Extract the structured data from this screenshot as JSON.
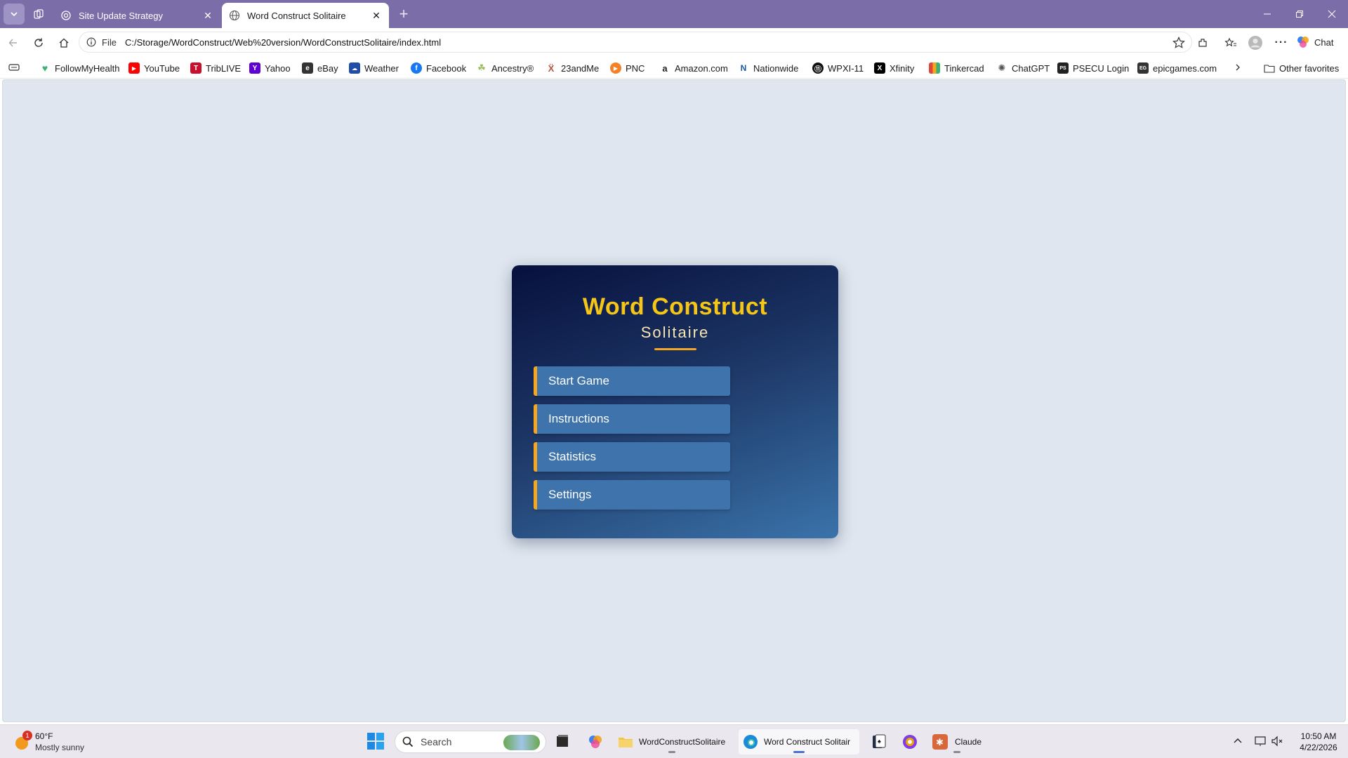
{
  "browser": {
    "tabs": [
      {
        "title": "Site Update Strategy",
        "icon": "openai-icon",
        "active": false
      },
      {
        "title": "Word Construct Solitaire",
        "icon": "globe-icon",
        "active": true
      }
    ],
    "address": {
      "file_label": "File",
      "url": "C:/Storage/WordConstruct/Web%20version/WordConstructSolitaire/index.html"
    },
    "chat_label": "Chat",
    "favorites": [
      {
        "label": "FollowMyHealth",
        "icon": "heart-icon",
        "color": "#3bb273"
      },
      {
        "label": "YouTube",
        "icon": "youtube-icon",
        "color": "#ff0000"
      },
      {
        "label": "TribLIVE",
        "icon": "triblive-icon",
        "color": "#c8102e"
      },
      {
        "label": "Yahoo",
        "icon": "yahoo-icon",
        "color": "#6001d2"
      },
      {
        "label": "eBay",
        "icon": "ebay-icon",
        "color": "#333333"
      },
      {
        "label": "Weather",
        "icon": "weather-icon",
        "color": "#1f4ea8"
      },
      {
        "label": "Facebook",
        "icon": "facebook-icon",
        "color": "#1877f2"
      },
      {
        "label": "Ancestry®",
        "icon": "ancestry-icon",
        "color": "#9bbb59"
      },
      {
        "label": "23andMe",
        "icon": "23andme-icon",
        "color": "#b5533c"
      },
      {
        "label": "PNC",
        "icon": "pnc-icon",
        "color": "#f58025"
      },
      {
        "label": "Amazon.com",
        "icon": "amazon-icon",
        "color": "#222222"
      },
      {
        "label": "Nationwide",
        "icon": "nationwide-icon",
        "color": "#1c57a5"
      },
      {
        "label": "WPXI-11",
        "icon": "wpxi-icon",
        "color": "#111111"
      },
      {
        "label": "Xfinity",
        "icon": "x-icon",
        "color": "#000000"
      },
      {
        "label": "Tinkercad",
        "icon": "tinkercad-icon",
        "color": "#e0473c"
      },
      {
        "label": "ChatGPT",
        "icon": "openai-icon",
        "color": "#555555"
      },
      {
        "label": "PSECU Login",
        "icon": "psecu-icon",
        "color": "#222222"
      },
      {
        "label": "epicgames.com",
        "icon": "epicgames-icon",
        "color": "#333333"
      }
    ],
    "other_favorites": "Other favorites"
  },
  "game": {
    "title": "Word Construct",
    "subtitle": "Solitaire",
    "menu": [
      "Start Game",
      "Instructions",
      "Statistics",
      "Settings"
    ],
    "colors": {
      "title": "#f5c518",
      "accent": "#f5a623",
      "button": "#3e73ab",
      "card_top": "#07103e",
      "card_bottom": "#3a73aa"
    }
  },
  "taskbar": {
    "weather": {
      "temp": "60°F",
      "desc": "Mostly sunny",
      "badge": "1"
    },
    "search_placeholder": "Search",
    "apps": [
      {
        "label": "WordConstructSolitaire",
        "icon": "folder-icon"
      },
      {
        "label": "Word Construct Solitair",
        "icon": "edge-icon"
      },
      {
        "label": "Claude",
        "icon": "claude-icon"
      }
    ],
    "time": "10:50 AM",
    "date": "4/22/2026"
  }
}
